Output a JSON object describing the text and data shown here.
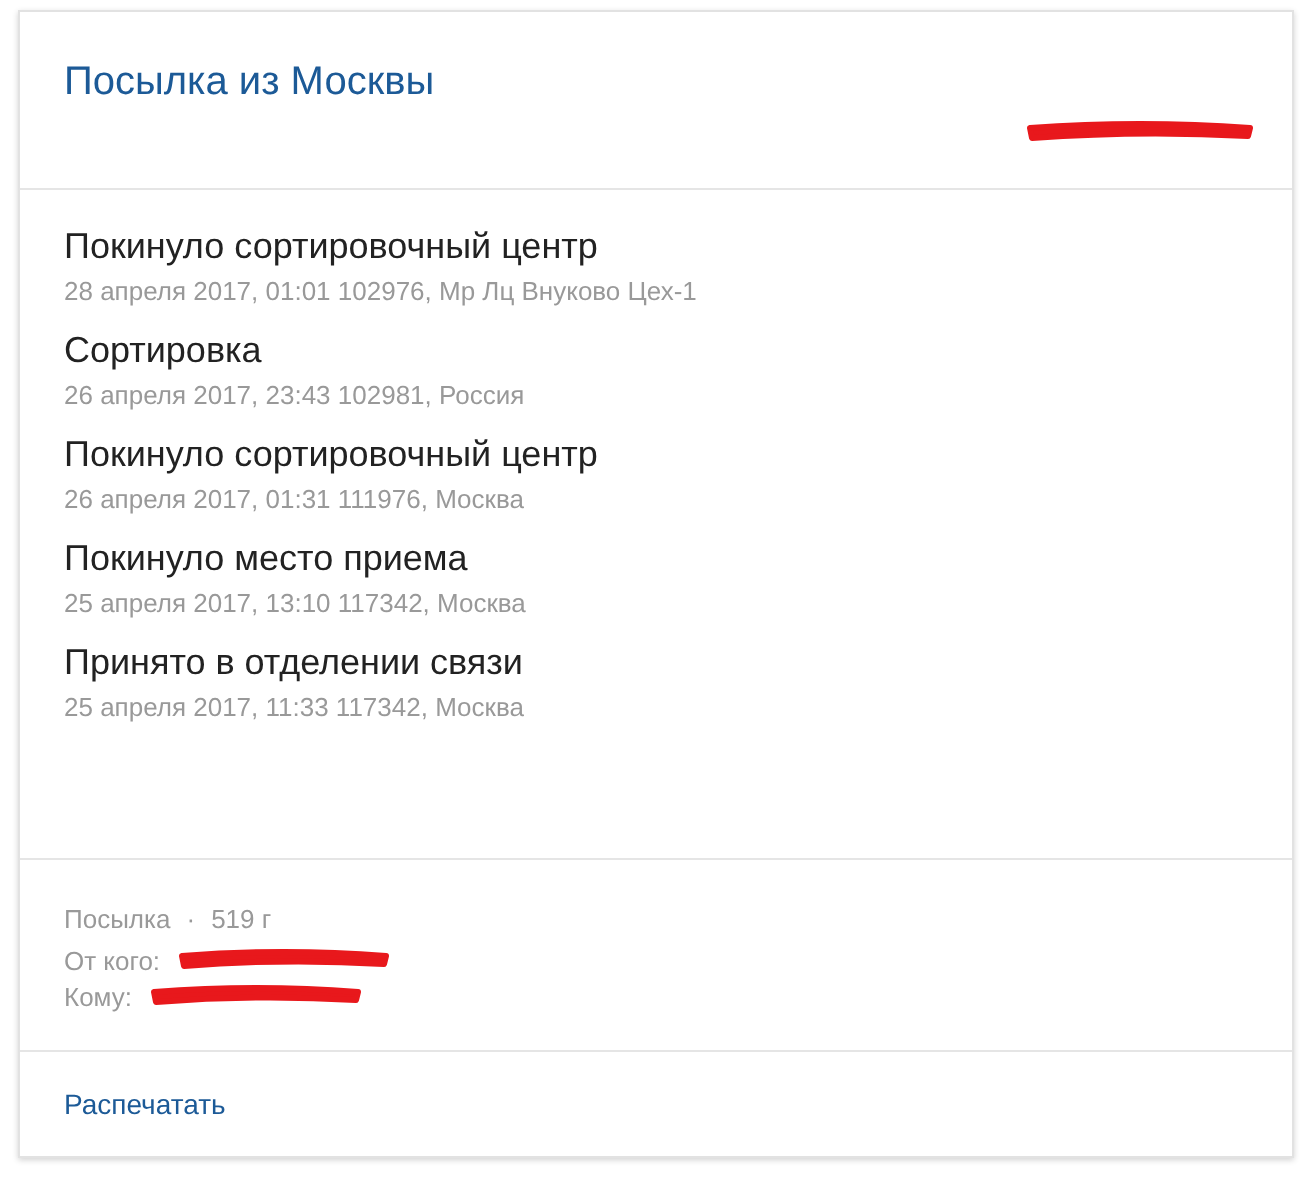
{
  "title": "Посылка из Москвы",
  "events": [
    {
      "status": "Покинуло сортировочный центр",
      "details": "28 апреля 2017, 01:01 102976, Мр Лц Внуково Цех-1"
    },
    {
      "status": "Сортировка",
      "details": "26 апреля 2017, 23:43 102981, Россия"
    },
    {
      "status": "Покинуло сортировочный центр",
      "details": "26 апреля 2017, 01:31 111976, Москва"
    },
    {
      "status": "Покинуло место приема",
      "details": "25 апреля 2017, 13:10 117342, Москва"
    },
    {
      "status": "Принято в отделении связи",
      "details": "25 апреля 2017, 11:33 117342, Москва"
    }
  ],
  "parcel": {
    "type": "Посылка",
    "separator": "·",
    "weight": "519 г",
    "from_label": "От кого:",
    "to_label": "Кому:"
  },
  "print_link": "Распечатать"
}
